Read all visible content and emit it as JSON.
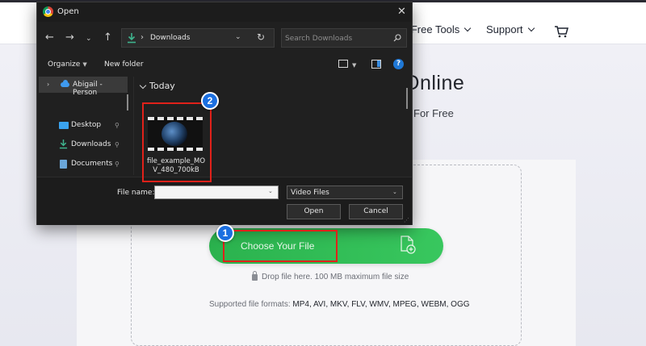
{
  "website": {
    "nav": {
      "tools_label": "e Free Tools",
      "support_label": "Support"
    },
    "hero": {
      "title": "Online",
      "subtitle": "For Free"
    },
    "upload": {
      "choose_label": "Choose Your File",
      "drop_text": "Drop file here. 100 MB maximum file size",
      "formats_label": "Supported file formats:",
      "formats_list": "MP4, AVI, MKV, FLV, WMV, MPEG, WEBM, OGG"
    }
  },
  "dialog": {
    "title": "Open",
    "address": {
      "path": "Downloads"
    },
    "search": {
      "placeholder": "Search Downloads"
    },
    "toolbar": {
      "organize_label": "Organize",
      "new_folder_label": "New folder"
    },
    "sidebar": {
      "items": [
        {
          "label": "Abigail - Person"
        },
        {
          "label": "Desktop"
        },
        {
          "label": "Downloads"
        },
        {
          "label": "Documents"
        }
      ]
    },
    "content": {
      "group_label": "Today",
      "file_name": "file_example_MOV_480_700kB"
    },
    "footer": {
      "file_name_label": "File name:",
      "file_name_value": "",
      "file_type": "Video Files",
      "open_label": "Open",
      "cancel_label": "Cancel"
    }
  },
  "annotations": {
    "step1": "1",
    "step2": "2"
  },
  "colors": {
    "accent_green": "#2bb24e",
    "annotation_red": "#e0211a",
    "badge_blue": "#1b6fe0",
    "dialog_bg": "#202020"
  }
}
